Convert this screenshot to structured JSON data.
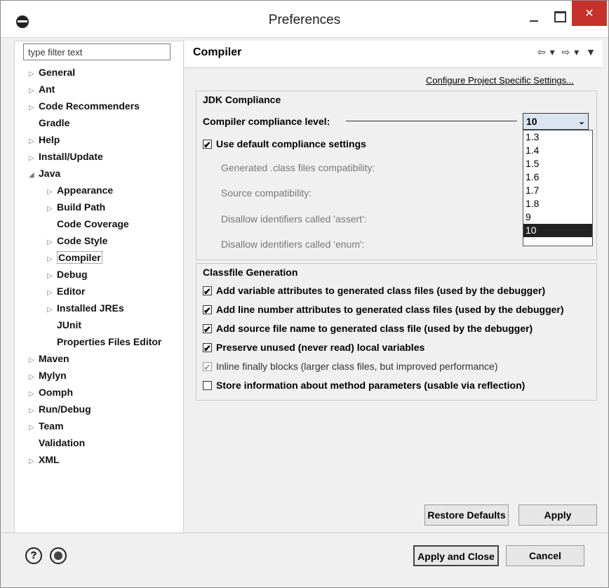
{
  "window": {
    "title": "Preferences"
  },
  "filter": {
    "placeholder": "type filter text"
  },
  "tree": {
    "items": [
      {
        "label": "General",
        "arrow": "▷"
      },
      {
        "label": "Ant",
        "arrow": "▷"
      },
      {
        "label": "Code Recommenders",
        "arrow": "▷"
      },
      {
        "label": "Gradle",
        "arrow": ""
      },
      {
        "label": "Help",
        "arrow": "▷"
      },
      {
        "label": "Install/Update",
        "arrow": "▷"
      },
      {
        "label": "Java",
        "arrow": "◢"
      },
      {
        "label": "Appearance",
        "arrow": "▷"
      },
      {
        "label": "Build Path",
        "arrow": "▷"
      },
      {
        "label": "Code Coverage",
        "arrow": ""
      },
      {
        "label": "Code Style",
        "arrow": "▷"
      },
      {
        "label": "Compiler",
        "arrow": "▷"
      },
      {
        "label": "Debug",
        "arrow": "▷"
      },
      {
        "label": "Editor",
        "arrow": "▷"
      },
      {
        "label": "Installed JREs",
        "arrow": "▷"
      },
      {
        "label": "JUnit",
        "arrow": ""
      },
      {
        "label": "Properties Files Editor",
        "arrow": ""
      },
      {
        "label": "Maven",
        "arrow": "▷"
      },
      {
        "label": "Mylyn",
        "arrow": "▷"
      },
      {
        "label": "Oomph",
        "arrow": "▷"
      },
      {
        "label": "Run/Debug",
        "arrow": "▷"
      },
      {
        "label": "Team",
        "arrow": "▷"
      },
      {
        "label": "Validation",
        "arrow": ""
      },
      {
        "label": "XML",
        "arrow": "▷"
      }
    ]
  },
  "page": {
    "title": "Compiler",
    "project_link": "Configure Project Specific Settings...",
    "nav": {
      "back": "⇦",
      "forward": "⇨",
      "dropdown": "▾",
      "menu": "▼"
    }
  },
  "jdk": {
    "group_title": "JDK Compliance",
    "compliance_label": "Compiler compliance level:",
    "compliance_value": "10",
    "combo_chevron": "⌄",
    "use_default_label": "Use default compliance settings",
    "generated_label": "Generated .class files compatibility:",
    "source_label": "Source compatibility:",
    "assert_label": "Disallow identifiers called 'assert':",
    "enum_label": "Disallow identifiers called 'enum':",
    "options": [
      "1.3",
      "1.4",
      "1.5",
      "1.6",
      "1.7",
      "1.8",
      "9",
      "10"
    ]
  },
  "classfile": {
    "group_title": "Classfile Generation",
    "options": [
      "Add variable attributes to generated class files (used by the debugger)",
      "Add line number attributes to generated class files (used by the debugger)",
      "Add source file name to generated class file (used by the debugger)",
      "Preserve unused (never read) local variables",
      "Inline finally blocks (larger class files, but improved performance)",
      "Store information about method parameters (usable via reflection)"
    ]
  },
  "buttons": {
    "restore_defaults": "Restore Defaults",
    "apply": "Apply",
    "apply_and_close": "Apply and Close",
    "cancel": "Cancel",
    "help": "?",
    "close_x": "✕"
  }
}
